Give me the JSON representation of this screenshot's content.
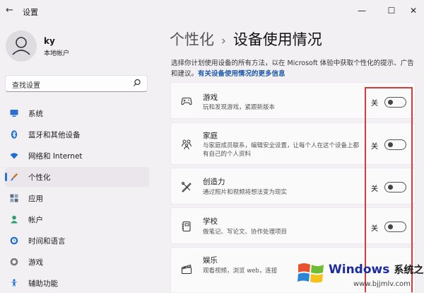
{
  "window": {
    "back_glyph": "←",
    "title": "设置",
    "controls": [
      "—",
      "☐",
      "✕"
    ]
  },
  "user": {
    "name": "ky",
    "account_type": "本地帐户"
  },
  "search": {
    "placeholder": "查找设置"
  },
  "nav": {
    "items": [
      {
        "label": "系统",
        "icon": "monitor-icon",
        "color": "#2b6fcf"
      },
      {
        "label": "蓝牙和其他设备",
        "icon": "bluetooth-icon",
        "color": "#1f6fd0"
      },
      {
        "label": "网络和 Internet",
        "icon": "wifi-icon",
        "color": "#1f6fd0"
      },
      {
        "label": "个性化",
        "icon": "brush-icon",
        "color": "#c8742c",
        "active": true
      },
      {
        "label": "应用",
        "icon": "apps-icon",
        "color": "#5a6f86"
      },
      {
        "label": "帐户",
        "icon": "person-icon",
        "color": "#2e9e6b"
      },
      {
        "label": "时间和语言",
        "icon": "globe-clock-icon",
        "color": "#1f6fd0"
      },
      {
        "label": "游戏",
        "icon": "gamepad-icon",
        "color": "#6b6b6b"
      },
      {
        "label": "辅助功能",
        "icon": "accessibility-icon",
        "color": "#1f6fd0"
      }
    ]
  },
  "breadcrumb": {
    "parent": "个性化",
    "separator": "›",
    "current": "设备使用情况"
  },
  "description": {
    "text": "选择你计划使用设备的所有方法，以在 Microsoft 体验中获取个性化的提示、广告和建议。",
    "link": "有关设备使用情况的更多信息"
  },
  "cards": [
    {
      "title": "游戏",
      "subtitle": "玩和发现游戏，紧跟新版本",
      "state_label": "关",
      "icon": "gamepad-icon"
    },
    {
      "title": "家庭",
      "subtitle": "与家庭成员联系，编辑安全设置，让每个人在这个设备上都有自己的个人资料",
      "state_label": "关",
      "icon": "family-icon"
    },
    {
      "title": "创造力",
      "subtitle": "通过照片和视频将想法变为现实",
      "state_label": "关",
      "icon": "creativity-icon"
    },
    {
      "title": "学校",
      "subtitle": "做笔记、写论文、协作处理项目",
      "state_label": "关",
      "icon": "notebook-icon"
    },
    {
      "title": "娱乐",
      "subtitle": "观看视频，浏览 web，连接",
      "state_label": "",
      "icon": "clapperboard-icon"
    }
  ],
  "watermark": {
    "brand": "Windows",
    "brand_cn": "系统之家",
    "url": "www.bjjmlv.com"
  },
  "colors": {
    "accent": "#2b6fcf",
    "highlight_box": "#d63a3a"
  }
}
